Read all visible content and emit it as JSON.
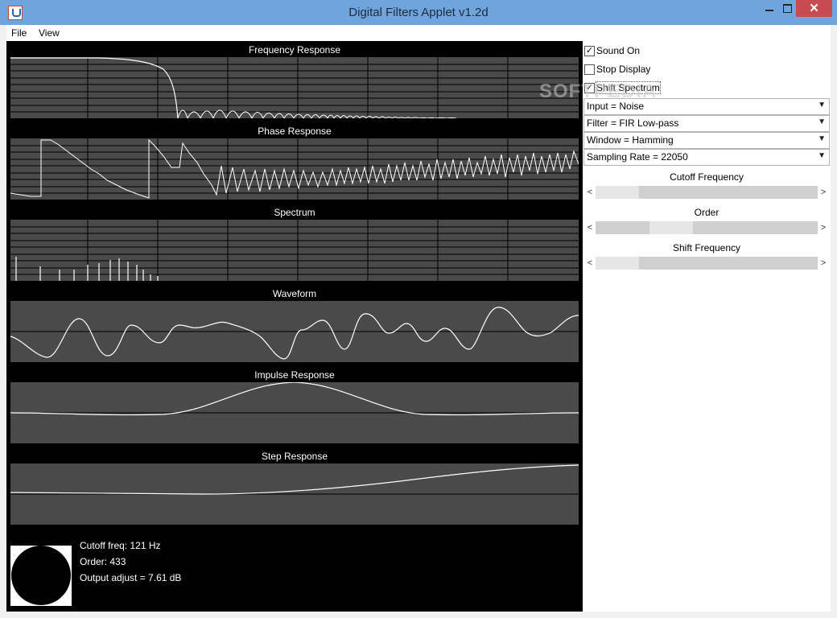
{
  "window": {
    "title": "Digital Filters Applet v1.2d",
    "close_glyph": "✕"
  },
  "menu": [
    {
      "label": "File"
    },
    {
      "label": "View"
    }
  ],
  "plots": {
    "frequency_response": {
      "title": "Frequency Response"
    },
    "phase_response": {
      "title": "Phase Response"
    },
    "spectrum": {
      "title": "Spectrum"
    },
    "waveform": {
      "title": "Waveform"
    },
    "impulse_response": {
      "title": "Impulse Response"
    },
    "step_response": {
      "title": "Step Response"
    }
  },
  "info": {
    "cutoff": "Cutoff freq: 121 Hz",
    "order": "Order: 433",
    "output": "Output adjust = 7.61 dB"
  },
  "controls": {
    "sound_on": {
      "label": "Sound On",
      "checked": true
    },
    "stop_display": {
      "label": "Stop Display",
      "checked": false
    },
    "shift_spectrum": {
      "label": "Shift Spectrum",
      "checked": true
    },
    "input": {
      "value": "Input = Noise"
    },
    "filter": {
      "value": "Filter = FIR Low-pass"
    },
    "window": {
      "value": "Window = Hamming"
    },
    "sampling": {
      "value": "Sampling Rate = 22050"
    },
    "cutoff_slider": {
      "label": "Cutoff Frequency",
      "position": 0.0
    },
    "order_slider": {
      "label": "Order",
      "position": 0.3
    },
    "shift_slider": {
      "label": "Shift Frequency",
      "position": 0.0
    }
  },
  "watermark": "SOFTPEDIA",
  "colors": {
    "plot_bg": "#4a4a4a",
    "trace": "#ffffff",
    "panel_bg": "#000000"
  }
}
